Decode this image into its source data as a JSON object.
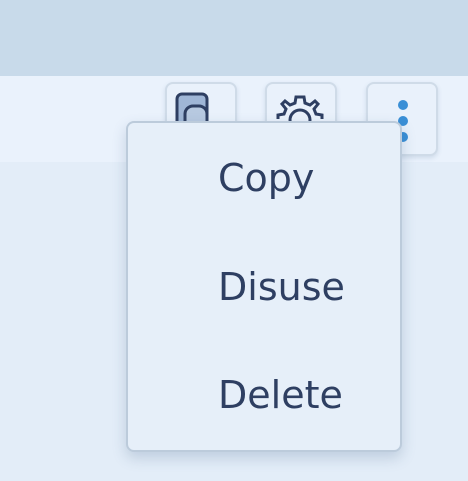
{
  "toolbar": {
    "buttons": [
      {
        "name": "copy",
        "icon": "copy-icon"
      },
      {
        "name": "settings",
        "icon": "gear-icon"
      },
      {
        "name": "more",
        "icon": "more-vertical-icon"
      }
    ]
  },
  "menu": {
    "items": [
      {
        "label": "Copy"
      },
      {
        "label": "Disuse"
      },
      {
        "label": "Delete"
      }
    ]
  },
  "colors": {
    "accent": "#3a8fd6",
    "text": "#2e3f62",
    "menu_bg": "#e6eff9"
  }
}
